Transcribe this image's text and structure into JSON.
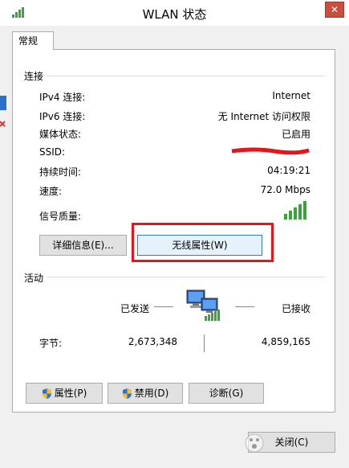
{
  "window": {
    "title": "WLAN 状态",
    "close_glyph": "✕"
  },
  "tab": {
    "label": "常规"
  },
  "connection": {
    "header": "连接",
    "rows": [
      {
        "label": "IPv4 连接:",
        "value": "Internet"
      },
      {
        "label": "IPv6 连接:",
        "value": "无 Internet 访问权限"
      },
      {
        "label": "媒体状态:",
        "value": "已启用"
      },
      {
        "label": "SSID:",
        "value": ""
      },
      {
        "label": "持续时间:",
        "value": "04:19:21"
      },
      {
        "label": "速度:",
        "value": "72.0 Mbps"
      },
      {
        "label": "信号质量:",
        "value": ""
      }
    ],
    "signal_bars": 5
  },
  "buttons": {
    "details": "详细信息(E)...",
    "wireless": "无线属性(W)"
  },
  "activity": {
    "header": "活动",
    "sent_label": "已发送",
    "received_label": "已接收",
    "bytes_label": "字节:",
    "sent_value": "2,673,348",
    "received_value": "4,859,165"
  },
  "bottom_buttons": {
    "properties": "属性(P)",
    "disable": "禁用(D)",
    "diagnose": "诊断(G)"
  },
  "ok_button": {
    "label": "关闭(C)"
  },
  "colors": {
    "annotation_red": "#e5161b",
    "signal_green": "#3aa33a",
    "close_red": "#c7503f"
  }
}
